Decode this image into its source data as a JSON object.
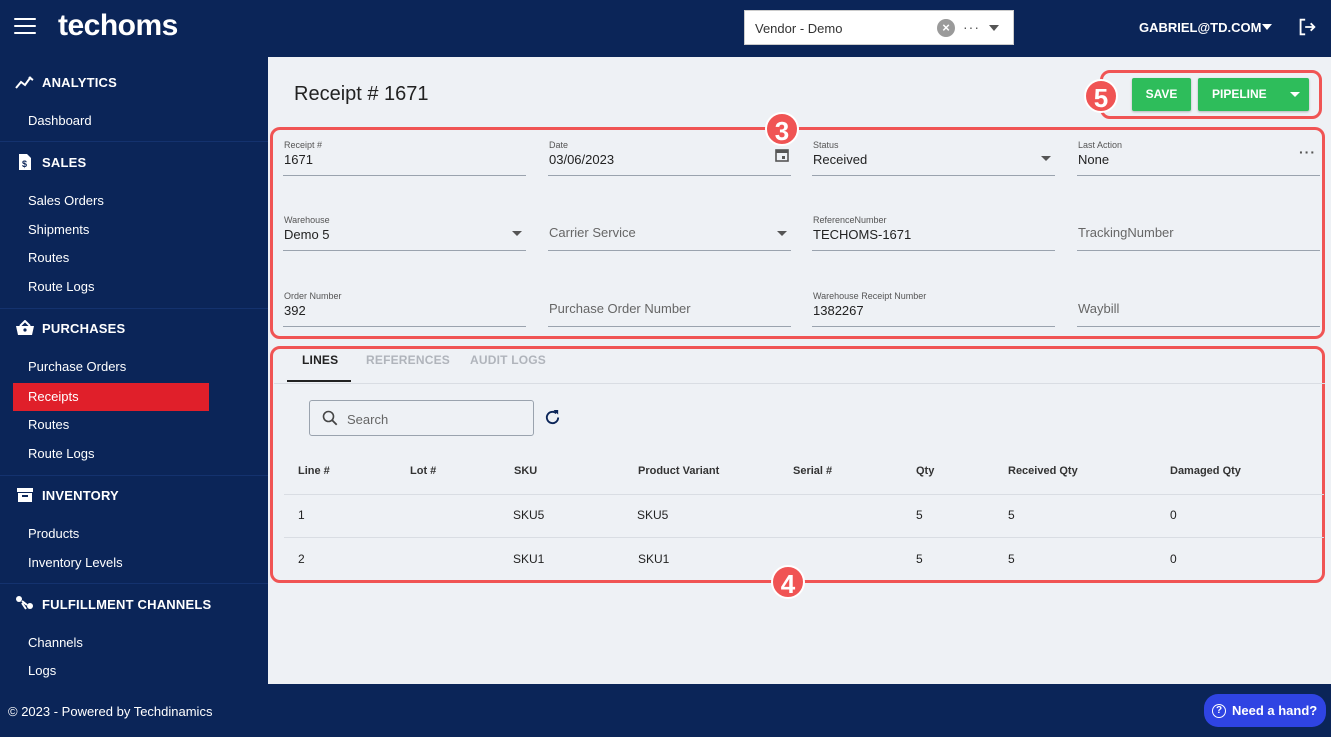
{
  "header": {
    "brand": "techoms",
    "vendor_value": "Vendor - Demo",
    "more": "···",
    "user": "GABRIEL@TD.COM"
  },
  "sidebar": {
    "sections": [
      {
        "label": "ANALYTICS",
        "icon": "chart-line-icon",
        "items": [
          "Dashboard"
        ]
      },
      {
        "label": "SALES",
        "icon": "dollar-document-icon",
        "items": [
          "Sales Orders",
          "Shipments",
          "Routes",
          "Route Logs"
        ]
      },
      {
        "label": "PURCHASES",
        "icon": "basket-icon",
        "items": [
          "Purchase Orders",
          "Receipts",
          "Routes",
          "Route Logs"
        ]
      },
      {
        "label": "INVENTORY",
        "icon": "archive-box-icon",
        "items": [
          "Products",
          "Inventory Levels"
        ]
      },
      {
        "label": "FULFILLMENT CHANNELS",
        "icon": "channels-icon",
        "items": [
          "Channels",
          "Logs"
        ]
      }
    ],
    "active_item": "Receipts"
  },
  "page": {
    "title": "Receipt # 1671",
    "save_label": "SAVE",
    "pipeline_label": "PIPELINE"
  },
  "annotations": {
    "three": "3",
    "four": "4",
    "five": "5"
  },
  "fields": {
    "receipt_no": {
      "label": "Receipt #",
      "value": "1671"
    },
    "date": {
      "label": "Date",
      "value": "03/06/2023"
    },
    "status": {
      "label": "Status",
      "value": "Received"
    },
    "last_action": {
      "label": "Last Action",
      "value": "None"
    },
    "warehouse": {
      "label": "Warehouse",
      "value": "Demo 5"
    },
    "carrier_service": {
      "placeholder": "Carrier Service"
    },
    "reference_number": {
      "label": "ReferenceNumber",
      "value": "TECHOMS-1671"
    },
    "tracking_number": {
      "placeholder": "TrackingNumber"
    },
    "order_number": {
      "label": "Order Number",
      "value": "392"
    },
    "purchase_order_number": {
      "placeholder": "Purchase Order Number"
    },
    "warehouse_receipt_number": {
      "label": "Warehouse Receipt Number",
      "value": "1382267"
    },
    "waybill": {
      "placeholder": "Waybill"
    }
  },
  "tabs": [
    "LINES",
    "REFERENCES",
    "AUDIT LOGS"
  ],
  "search": {
    "placeholder": "Search"
  },
  "table": {
    "headers": [
      "Line #",
      "Lot #",
      "SKU",
      "Product Variant",
      "Serial #",
      "Qty",
      "Received Qty",
      "Damaged Qty"
    ],
    "rows": [
      [
        "1",
        "",
        "SKU5",
        "SKU5",
        "",
        "5",
        "5",
        "0"
      ],
      [
        "2",
        "",
        "SKU1",
        "SKU1",
        "",
        "5",
        "5",
        "0"
      ]
    ]
  },
  "footer": {
    "copyright": "© 2023 - Powered by Techdinamics",
    "help": "Need a hand?"
  },
  "colors": {
    "navy": "#0b2558",
    "active_red": "#e01f2a",
    "green": "#2ebd5b",
    "annotation": "#f05454",
    "help_blue": "#2f44e3"
  }
}
